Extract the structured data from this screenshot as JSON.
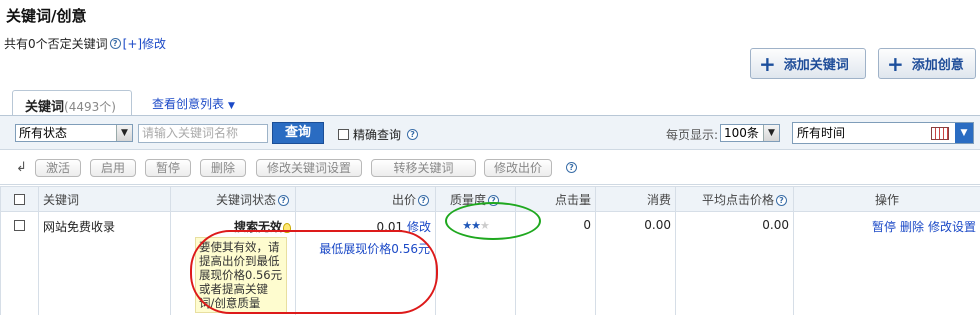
{
  "page_title": "关键词/创意",
  "negative": {
    "text": "共有0个否定关键词",
    "modify_link": "[+]修改"
  },
  "buttons": {
    "add_keyword": "添加关键词",
    "add_creative": "添加创意"
  },
  "tabs": {
    "active_label": "关键词",
    "active_count": "(4493个)",
    "other_label": "查看创意列表",
    "other_arrow": "▼"
  },
  "filter": {
    "status_value": "所有状态",
    "keyword_placeholder": "请输入关键词名称",
    "query_label": "查询",
    "exact_label": "精确查询",
    "perpage_label": "每页显示:",
    "perpage_value": "100条",
    "time_value": "所有时间"
  },
  "actions": {
    "arrow": "↲",
    "items": [
      "激活",
      "启用",
      "暂停",
      "删除",
      "修改关键词设置",
      "转移关键词",
      "修改出价"
    ]
  },
  "table": {
    "headers": [
      "关键词",
      "关键词状态",
      "出价",
      "质量度",
      "点击量",
      "消费",
      "平均点击价格",
      "操作"
    ],
    "row": {
      "keyword": "网站免费收录",
      "status": "搜索无效",
      "bid": "0.01",
      "bid_modify": "修改",
      "clicks": "0",
      "cost": "0.00",
      "avg_price": "0.00",
      "ops": [
        "暂停",
        "删除",
        "修改设置"
      ],
      "quality_stars": 2,
      "quality_max": 3,
      "tip": "要使其有效，请提高出价到最低展现价格0.56元或者提高关键词/创意质量",
      "min_price": "最低展现价格0.56元"
    }
  },
  "icons": {
    "help": "?",
    "plus": "+",
    "dropdown": "▼",
    "star": "★"
  },
  "colors": {
    "link": "#1c4ac7",
    "primary_button": "#2a6cc2",
    "header_bg": "#eef3f8",
    "highlight_red": "#dd1a1a",
    "highlight_green": "#1fa81f"
  }
}
